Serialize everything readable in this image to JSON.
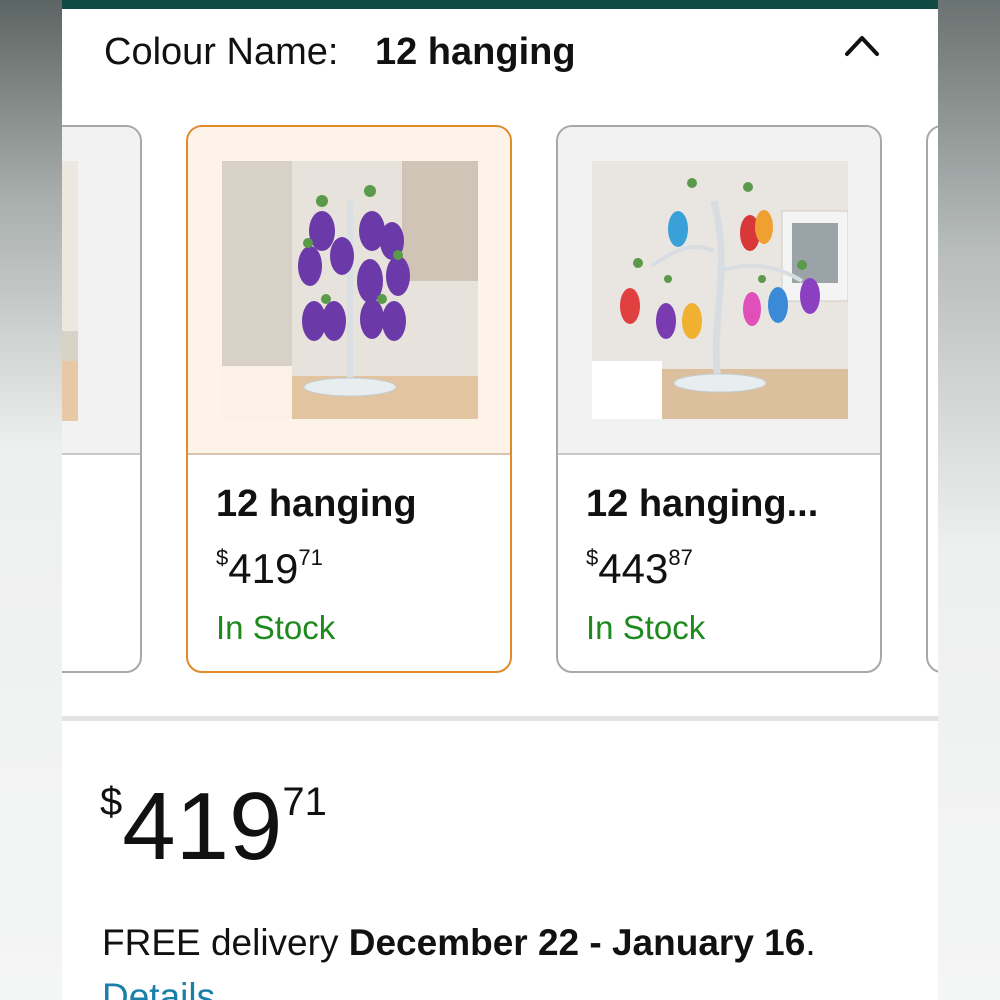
{
  "colour": {
    "label": "Colour Name:",
    "value": "12 hanging"
  },
  "icons": {
    "collapse": "chevron-up-icon"
  },
  "variants": [
    {
      "title": "",
      "price_symbol": "",
      "price_whole": "",
      "price_fraction": "",
      "stock": "",
      "selected": false,
      "partial": true
    },
    {
      "title": "12 hanging",
      "price_symbol": "$",
      "price_whole": "419",
      "price_fraction": "71",
      "stock": "In Stock",
      "selected": true
    },
    {
      "title": "12 hanging...",
      "price_symbol": "$",
      "price_whole": "443",
      "price_fraction": "87",
      "stock": "In Stock",
      "selected": false
    }
  ],
  "price": {
    "symbol": "$",
    "whole": "419",
    "fraction": "71"
  },
  "delivery": {
    "prefix": "FREE delivery ",
    "dates": "December 22 - January 16",
    "suffix": "."
  },
  "details_link": "Details",
  "colors": {
    "accent_top": "#0f4a45",
    "selected_border": "#e08a2a",
    "in_stock": "#1e8a1e",
    "link": "#1a7fa8"
  }
}
